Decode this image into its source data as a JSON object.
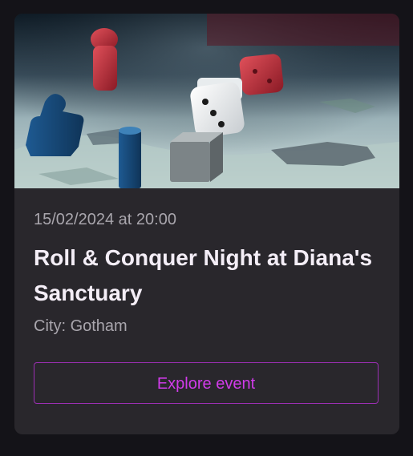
{
  "event": {
    "image_alt": "Board game pieces and dice on a game board",
    "date": "15/02/2024 at 20:00",
    "title": "Roll & Conquer Night at Diana's Sanctuary",
    "city_prefix": "City: ",
    "city": "Gotham",
    "button_label": "Explore event"
  },
  "colors": {
    "page_bg": "#141318",
    "card_bg": "#29272c",
    "accent": "#d03be9",
    "button_border": "#9b2fb3",
    "title": "#f4eef7",
    "muted_text": "#a9a6ad"
  }
}
